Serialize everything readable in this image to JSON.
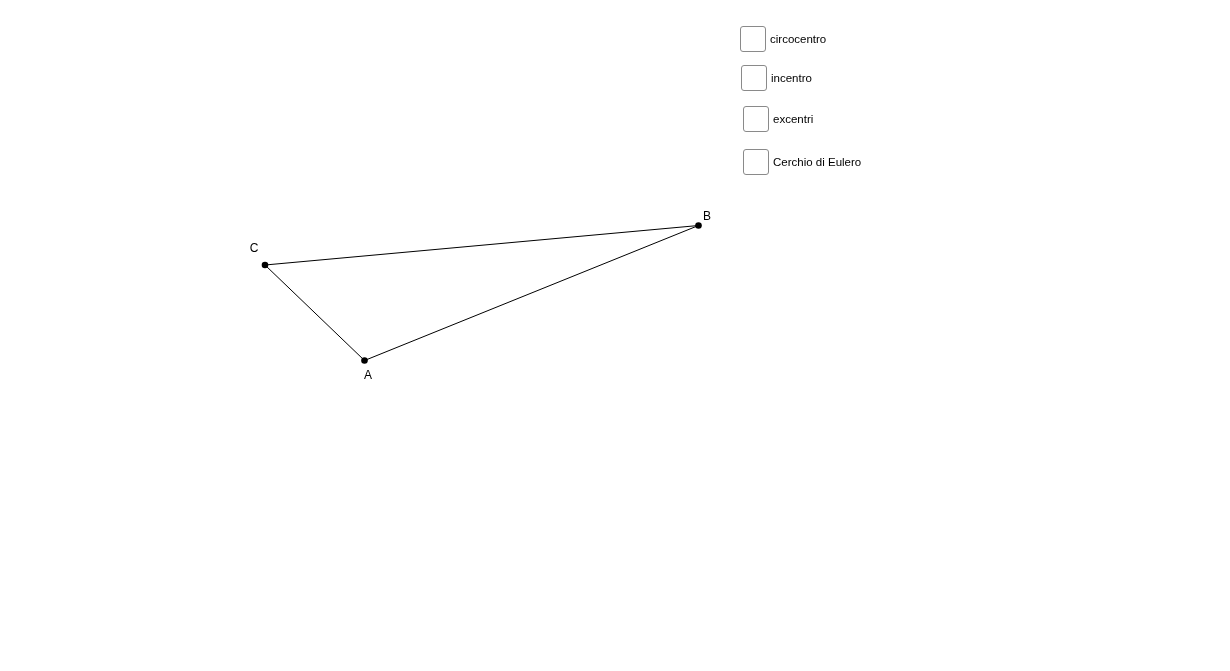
{
  "checkboxes": [
    {
      "label": "circocentro",
      "checked": false
    },
    {
      "label": "incentro",
      "checked": false
    },
    {
      "label": "excentri",
      "checked": false
    },
    {
      "label": "Cerchio di Eulero",
      "checked": false
    }
  ],
  "points": [
    {
      "label": "A"
    },
    {
      "label": "B"
    },
    {
      "label": "C"
    }
  ]
}
